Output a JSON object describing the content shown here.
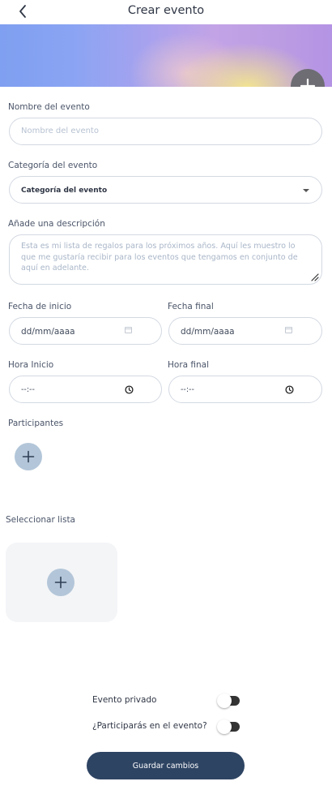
{
  "header": {
    "title": "Crear evento",
    "back_icon": "chevron-left-icon"
  },
  "banner": {
    "add_icon": "plus-icon"
  },
  "form": {
    "event_name": {
      "label": "Nombre del evento",
      "placeholder": "Nombre del evento"
    },
    "category": {
      "label": "Categoría del evento",
      "selected": "Categoría del evento"
    },
    "description": {
      "label": "Añade una descripción",
      "placeholder": "Esta es mi lista de regalos para los próximos años. Aquí les muestro lo que me gustaría recibir para los eventos que tengamos en conjunto de aquí en adelante."
    },
    "start_date": {
      "label": "Fecha de inicio",
      "value": "dd/mm/aaaa"
    },
    "end_date": {
      "label": "Fecha final",
      "value": "dd/mm/aaaa"
    },
    "start_time": {
      "label": "Hora Inicio",
      "value": "--:--"
    },
    "end_time": {
      "label": "Hora final",
      "value": "--:--"
    }
  },
  "participants": {
    "label": "Participantes"
  },
  "select_list": {
    "label": "Seleccionar lista"
  },
  "toggles": {
    "private_event": {
      "label": "Evento privado",
      "state": "off"
    },
    "participate": {
      "label": "¿Participarás en el evento?",
      "state": "off"
    }
  },
  "actions": {
    "save_label": "Guardar cambios"
  },
  "colors": {
    "primary": "#2e4463",
    "add_circle": "#b3c6d9",
    "banner_add": "#6d6d73"
  }
}
